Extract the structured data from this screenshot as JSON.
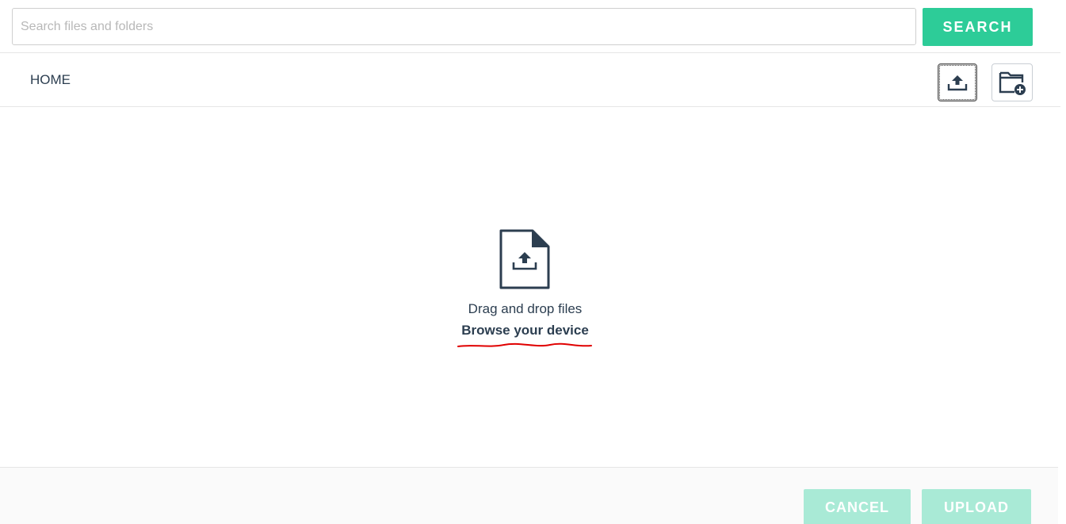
{
  "search": {
    "placeholder": "Search files and folders",
    "button_label": "SEARCH"
  },
  "breadcrumb": {
    "home_label": "HOME"
  },
  "toolbar": {
    "upload_icon": "upload-icon",
    "new_folder_icon": "new-folder-icon"
  },
  "dropzone": {
    "icon": "file-upload-icon",
    "drag_text": "Drag and drop files",
    "browse_label": "Browse your device"
  },
  "footer": {
    "cancel_label": "CANCEL",
    "upload_label": "UPLOAD"
  },
  "colors": {
    "accent": "#2dcc98",
    "accent_disabled": "#a9ead6",
    "text": "#2c3e50",
    "annotation_underline": "#e00000"
  }
}
